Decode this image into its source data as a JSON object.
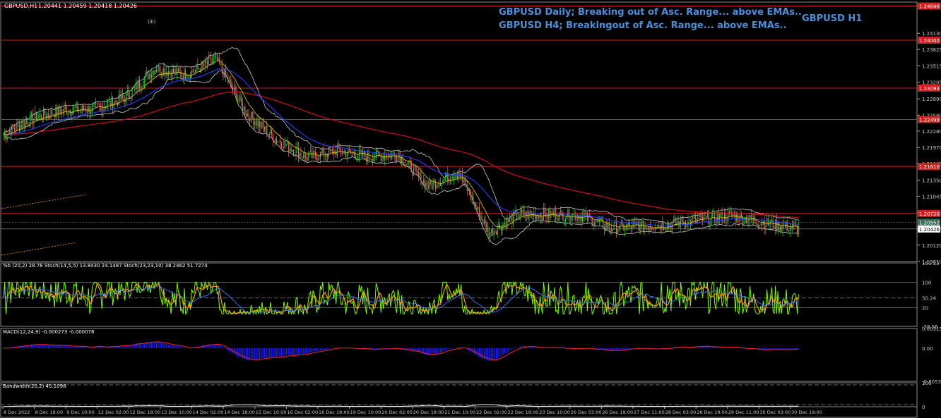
{
  "window": {
    "title": "GBPUSD,H1",
    "ohlc": "1.20441 1.20459 1.20418 1.20426"
  },
  "annotations": {
    "daily": "GBPUSD Daily; Breaking out of Asc. Range... above EMAs..",
    "h4": "GBPUSD H4;  Breakingout of Asc. Range... above EMAs..",
    "pair_tf": "GBPUSD H1",
    "wave_label": "(iii)"
  },
  "colors": {
    "bg": "#000000",
    "bull": "#2ecc40",
    "bear": "#f07070",
    "ema_red": "#d01010",
    "ema_blue": "#2040ff",
    "ema_yellow": "#d8c000",
    "bands": "#c8c8c8",
    "hline": "#d02020",
    "annotation": "#4a90d9",
    "axis_text": "#c8c8c8",
    "stoch_green": "#7cfc00",
    "stoch_orange": "#ff9c00",
    "stoch_blue": "#3080ff",
    "macd_hist": "#2020ff",
    "macd_signal": "#ff2020",
    "bandwidth": "#ffffff"
  },
  "price_axis": {
    "ticks": [
      "1.24646",
      "1.24130",
      "1.23825",
      "1.23515",
      "1.23205",
      "1.22890",
      "1.22580",
      "1.22280",
      "1.21970",
      "1.21665",
      "1.21350",
      "1.21045",
      "1.20730",
      "1.20426",
      "1.20120",
      "1.19810"
    ],
    "hlines": [
      {
        "value": 1.24646,
        "label": "1.24646"
      },
      {
        "value": 1.24,
        "label": "1.24000"
      },
      {
        "value": 1.23093,
        "label": "1.23093"
      },
      {
        "value": 1.22499,
        "label": "1.22499"
      },
      {
        "value": 1.2161,
        "label": "1.21610"
      },
      {
        "value": 1.2072,
        "label": "1.20720"
      }
    ],
    "current": {
      "value": 1.20426,
      "label": "1.20426"
    },
    "prev": {
      "value": 1.20552,
      "label": "1.20552"
    }
  },
  "chart_data": [
    {
      "type": "candlestick",
      "title": "GBPUSD,H1",
      "ylim": [
        1.1981,
        1.2472
      ],
      "x_labels": [
        "8 Dec 2022",
        "8 Dec 18:00",
        "9 Dec 10:00",
        "12 Dec 02:00",
        "12 Dec 18:00",
        "13 Dec 10:00",
        "14 Dec 02:00",
        "14 Dec 18:00",
        "15 Dec 10:00",
        "16 Dec 02:00",
        "16 Dec 18:00",
        "19 Dec 10:00",
        "20 Dec 02:00",
        "20 Dec 18:00",
        "21 Dec 10:00",
        "22 Dec 02:00",
        "22 Dec 18:00",
        "23 Dec 10:00",
        "26 Dec 03:00",
        "26 Dec 19:00",
        "27 Dec 11:00",
        "28 Dec 03:00",
        "28 Dec 19:00",
        "29 Dec 11:00",
        "30 Dec 03:00",
        "30 Dec 19:00"
      ],
      "series": [
        {
          "name": "close",
          "x": [
            0,
            25,
            50,
            75,
            100,
            125,
            150,
            175,
            200,
            225,
            250,
            275,
            300,
            325,
            350,
            375,
            400,
            425,
            450,
            475,
            500,
            525,
            550,
            575,
            600,
            625,
            655
          ],
          "values": [
            1.2222,
            1.2253,
            1.2268,
            1.227,
            1.2291,
            1.2347,
            1.2334,
            1.2364,
            1.2262,
            1.2212,
            1.2178,
            1.219,
            1.218,
            1.2183,
            1.2123,
            1.215,
            1.2035,
            1.207,
            1.207,
            1.2068,
            1.2045,
            1.2048,
            1.2052,
            1.206,
            1.2068,
            1.2055,
            1.2043
          ]
        }
      ]
    },
    {
      "type": "line",
      "title": "%b (20,2) 28.78  Stoch(14,5,5) 13.8430 24.1487  Stoch(23,23,10) 38.2462 51.7274",
      "y_ticks": [
        "161.13",
        "100",
        "50.24",
        "20",
        "-39.56"
      ],
      "ylim": [
        -39.56,
        161.13
      ]
    },
    {
      "type": "bar",
      "title": "MACD(12,24,9) -0.000273 -0.000078",
      "y_ticks": [
        "0.00315",
        "0.00",
        "-0.00533"
      ],
      "ylim": [
        -0.00533,
        0.00315
      ]
    },
    {
      "type": "line",
      "title": "Bandwidth(20,2) 45.1098",
      "y_ticks": [
        "100",
        "0"
      ],
      "ylim": [
        0,
        100
      ]
    }
  ]
}
